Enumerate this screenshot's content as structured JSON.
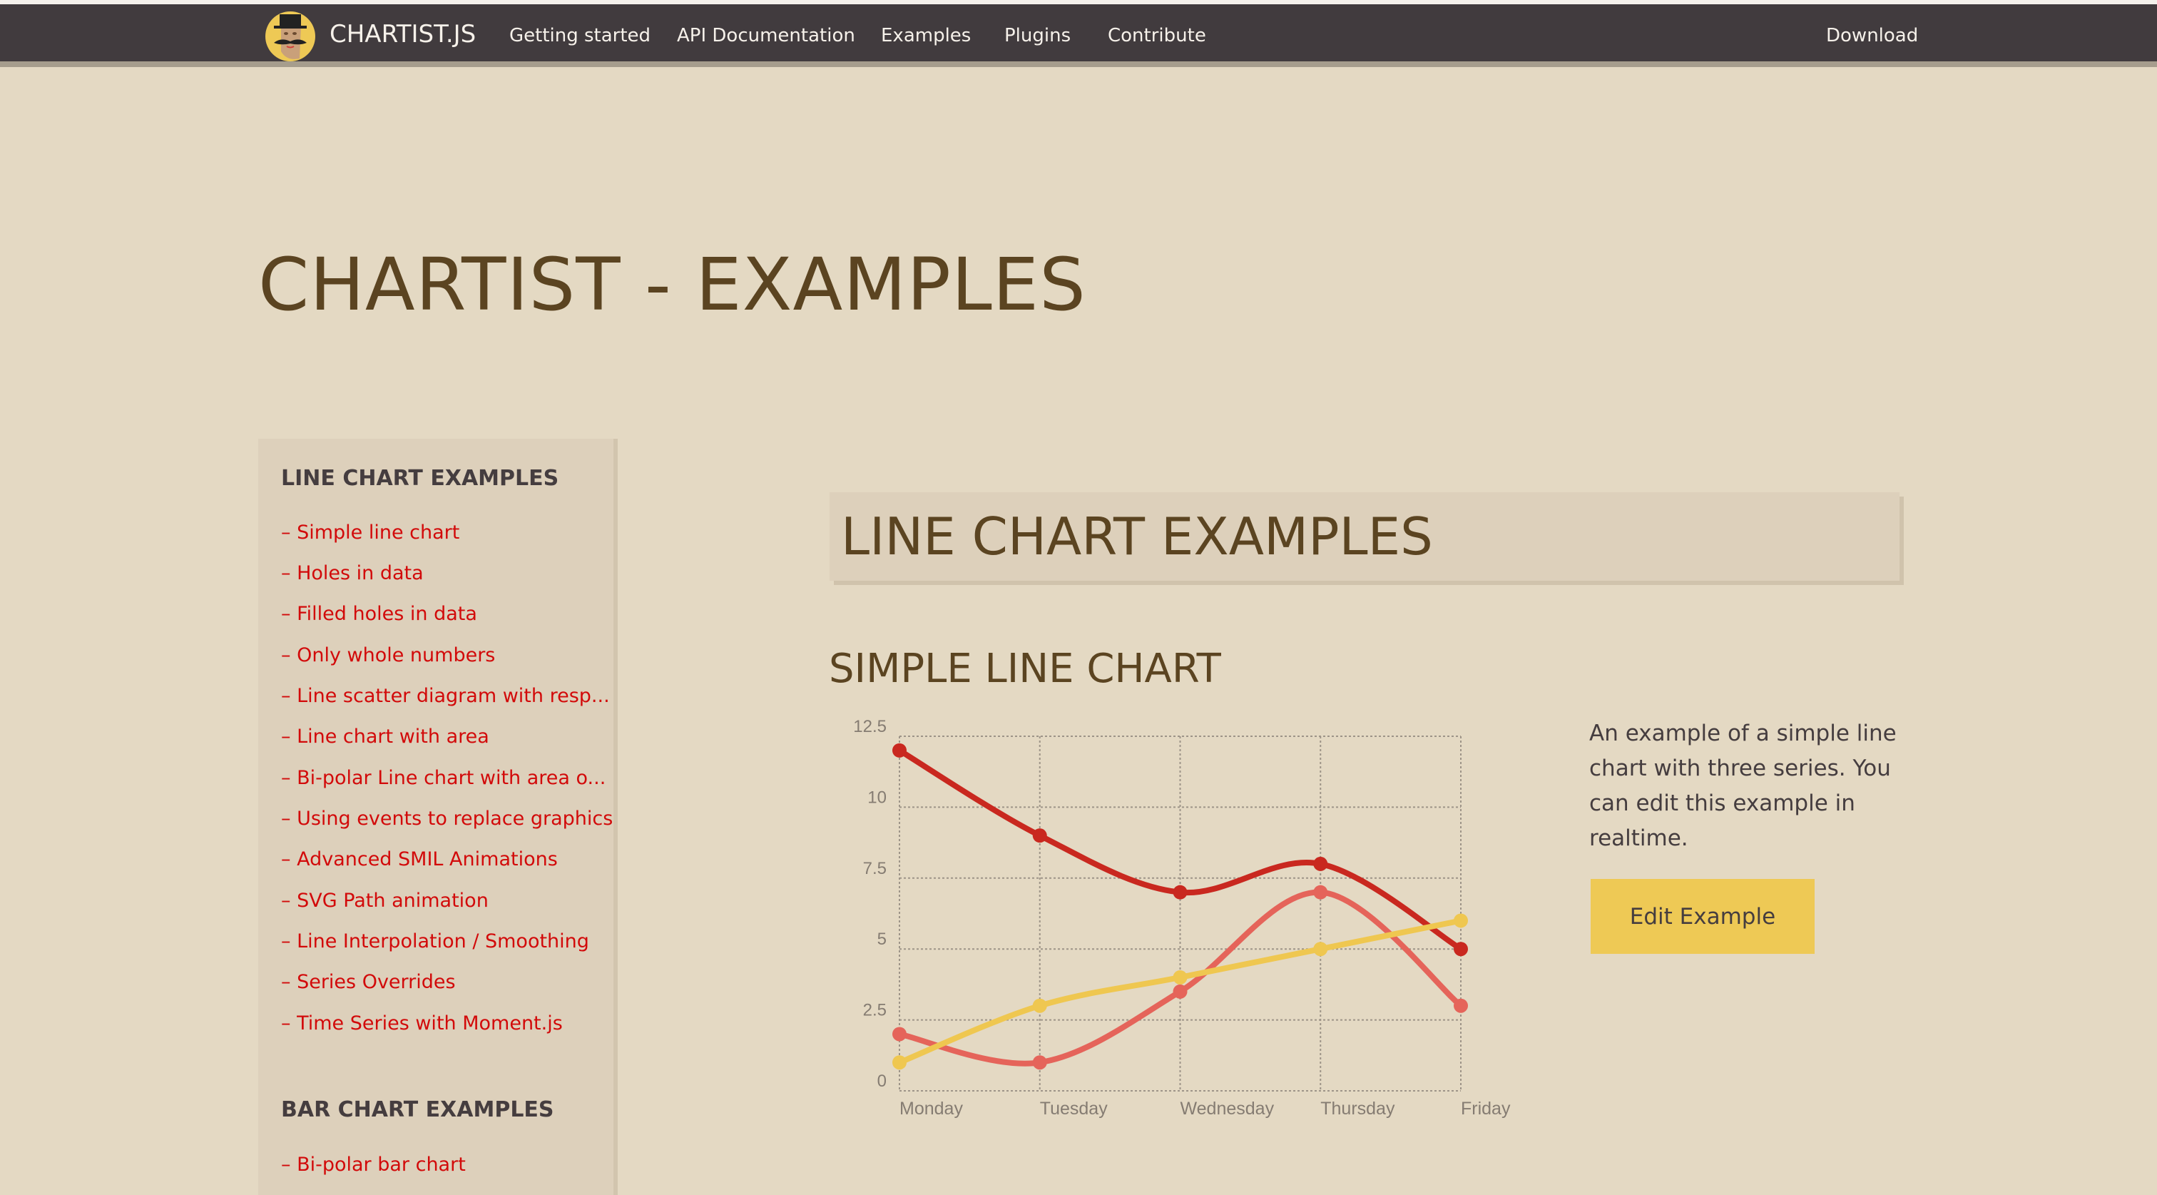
{
  "nav": {
    "brand": "CHARTIST.JS",
    "items": [
      "Getting started",
      "API Documentation",
      "Examples",
      "Plugins",
      "Contribute"
    ],
    "download": "Download"
  },
  "page_title": "CHARTIST - EXAMPLES",
  "sidebar": {
    "sections": [
      {
        "heading": "LINE CHART EXAMPLES",
        "items": [
          "– Simple line chart",
          "– Holes in data",
          "– Filled holes in data",
          "– Only whole numbers",
          "– Line scatter diagram with resp...",
          "– Line chart with area",
          "– Bi-polar Line chart with area o...",
          "– Using events to replace graphics",
          "– Advanced SMIL Animations",
          "– SVG Path animation",
          "– Line Interpolation / Smoothing",
          "– Series Overrides",
          "– Time Series with Moment.js"
        ]
      },
      {
        "heading": "BAR CHART EXAMPLES",
        "items": [
          "– Bi-polar bar chart"
        ]
      }
    ]
  },
  "main": {
    "section_title": "LINE CHART EXAMPLES",
    "example_title": "SIMPLE LINE CHART",
    "description": "An example of a simple line chart with three series. You can edit this example in realtime.",
    "edit_button": "Edit Example"
  },
  "colors": {
    "nav": "#413b3e",
    "link": "#d20a0a",
    "series_a": "#c9281f",
    "series_b": "#e5645a",
    "series_c": "#efc750",
    "button": "#eec955"
  },
  "chart_data": {
    "type": "line",
    "categories": [
      "Monday",
      "Tuesday",
      "Wednesday",
      "Thursday",
      "Friday"
    ],
    "series": [
      {
        "values": [
          12,
          9,
          7,
          8,
          5
        ]
      },
      {
        "values": [
          2,
          1,
          3.5,
          7,
          3
        ]
      },
      {
        "values": [
          1,
          3,
          4,
          5,
          6
        ]
      }
    ],
    "ylim": [
      0,
      12.5
    ],
    "yticks": [
      "0",
      "2.5",
      "5",
      "7.5",
      "10",
      "12.5"
    ],
    "grid": true,
    "smooth": true
  }
}
